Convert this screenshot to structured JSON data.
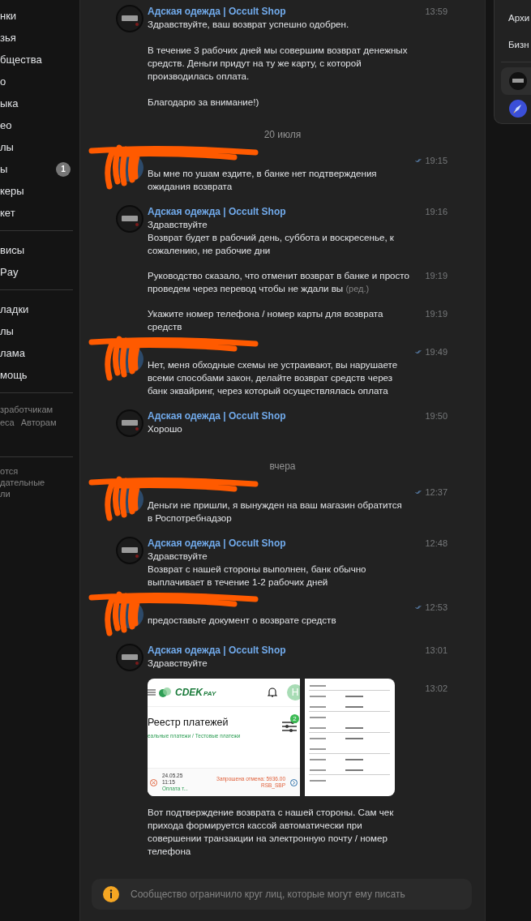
{
  "sidebar": {
    "groups": [
      [
        {
          "label": "нки"
        },
        {
          "label": "зья"
        },
        {
          "label": "бщества"
        },
        {
          "label": "о"
        },
        {
          "label": "ыка"
        },
        {
          "label": "ео"
        },
        {
          "label": "лы"
        },
        {
          "label": "ы",
          "badge": "1"
        },
        {
          "label": "керы"
        },
        {
          "label": "кет"
        }
      ],
      [
        {
          "label": "висы"
        },
        {
          "label": "Pay"
        }
      ],
      [
        {
          "label": "ладки"
        },
        {
          "label": "лы"
        },
        {
          "label": "лама"
        },
        {
          "label": "мощь"
        }
      ]
    ],
    "footer_links": [
      [
        "зработчикам"
      ],
      [
        "еса",
        "Авторам"
      ]
    ],
    "footer_note": "отся\nдательные\nли"
  },
  "chat": {
    "items": [
      {
        "kind": "message",
        "sender": {
          "kind": "shop",
          "name": "Адская одежда | Occult Shop"
        },
        "entries": [
          {
            "time": "13:59",
            "read": false,
            "text": "Здравствуйте, ваш возврат успешно одобрен.\n\nВ течение 3 рабочих дней мы совершим возврат денежных\nсредств. Деньги придут на ту же карту, с которой\nпроизводилась оплата.\n\nБлагодарю за внимание!)"
          }
        ]
      },
      {
        "kind": "date",
        "label": "20 июля"
      },
      {
        "kind": "message",
        "sender": {
          "kind": "redacted"
        },
        "entries": [
          {
            "time": "19:15",
            "read": true,
            "text": "Вы мне по ушам ездите, в банке нет подтверждения\nожидания возврата"
          }
        ]
      },
      {
        "kind": "message",
        "sender": {
          "kind": "shop",
          "name": "Адская одежда | Occult Shop"
        },
        "entries": [
          {
            "time": "19:16",
            "read": false,
            "text": "Здравствуйте\nВозврат будет в рабочий день, суббота и воскресенье, к\nсожалению, не рабочие дни"
          },
          {
            "time": "19:19",
            "read": false,
            "text": "Руководство сказало, что отменит возврат в банке и просто\nпроведем через перевод чтобы не ждали вы",
            "edited": "(ред.)"
          },
          {
            "time": "19:19",
            "read": false,
            "text": "Укажите номер телефона / номер карты для возврата\nсредств"
          }
        ]
      },
      {
        "kind": "message",
        "sender": {
          "kind": "redacted"
        },
        "entries": [
          {
            "time": "19:49",
            "read": true,
            "text": "Нет, меня обходные схемы не устраивают, вы нарушаете\nвсеми способами закон, делайте возврат средств через\nбанк эквайринг, через который осуществлялась оплата"
          }
        ]
      },
      {
        "kind": "message",
        "sender": {
          "kind": "shop",
          "name": "Адская одежда | Occult Shop"
        },
        "entries": [
          {
            "time": "19:50",
            "read": false,
            "text": "Хорошо"
          }
        ]
      },
      {
        "kind": "date",
        "label": "вчера"
      },
      {
        "kind": "message",
        "sender": {
          "kind": "redacted"
        },
        "entries": [
          {
            "time": "12:37",
            "read": true,
            "text": "Деньги не пришли, я вынужден на ваш магазин обратится\nв Роспотребнадзор"
          }
        ]
      },
      {
        "kind": "message",
        "sender": {
          "kind": "shop",
          "name": "Адская одежда | Occult Shop"
        },
        "entries": [
          {
            "time": "12:48",
            "read": false,
            "text": "Здравствуйте\nВозврат с нашей стороны выполнен, банк обычно\nвыплачивает в течение 1-2 рабочих дней"
          }
        ]
      },
      {
        "kind": "message",
        "sender": {
          "kind": "redacted"
        },
        "entries": [
          {
            "time": "12:53",
            "read": true,
            "text": "предоставьте документ о возврате средств"
          }
        ]
      },
      {
        "kind": "message",
        "sender": {
          "kind": "shop",
          "name": "Адская одежда | Occult Shop"
        },
        "entries": [
          {
            "time": "13:01",
            "read": false,
            "text": "Здравствуйте"
          },
          {
            "time": "13:02",
            "read": false,
            "text": "Вот подтверждение возврата с нашей стороны. Сам чек\nприхода формируется кассой автоматически при\nсовершении транзакции на электронную почту / номер\nтелефона",
            "attachments": [
              {
                "kind": "payments_screenshot",
                "logo": "CDEK",
                "logo_suffix": "PAY",
                "avatar_letter": "Н",
                "filter_count": "2",
                "title": "Реестр платежей",
                "links": "еальные платежи / Тестовые платежи",
                "row": {
                  "date": "24.05.25",
                  "time": "11:15",
                  "status": "Оплата т...",
                  "amount": "Запрошена отмена: 5936.00",
                  "method": "RSB_SBP"
                }
              },
              {
                "kind": "receipt"
              }
            ]
          }
        ]
      }
    ],
    "notice": "Сообщество ограничило круг лиц, которые могут ему писать"
  },
  "right_panel": {
    "items": [
      {
        "label": "Архи"
      },
      {
        "label": "Бизн"
      }
    ],
    "chats": [
      {
        "kind": "shop",
        "selected": true
      },
      {
        "kind": "rocket",
        "selected": false
      }
    ]
  }
}
